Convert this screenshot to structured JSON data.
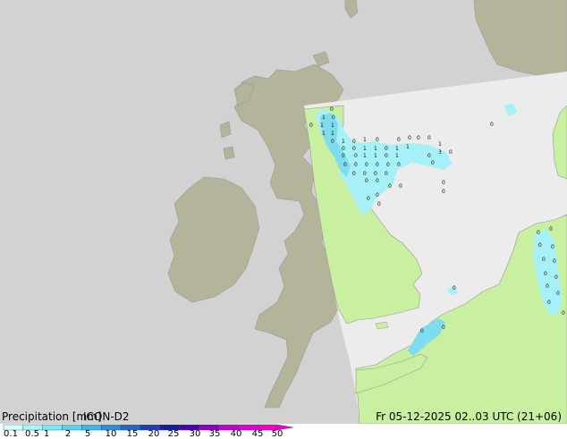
{
  "title": "Precipitation [mm]",
  "model": "ICON-D2",
  "datetime": "Fr 05-12-2025 02..03 UTC (21+06)",
  "colorbar": {
    "ticks": [
      "0.1",
      "0.5",
      "1",
      "2",
      "5",
      "10",
      "15",
      "20",
      "25",
      "30",
      "35",
      "40",
      "45",
      "50"
    ],
    "colors": [
      "#d0ffff",
      "#a8f5ff",
      "#7fe6f7",
      "#5ad2ec",
      "#3cb6e6",
      "#2b8fdc",
      "#2466cc",
      "#1e3fb8",
      "#1a1aa0",
      "#4b00b4",
      "#8a00c8",
      "#c000d2",
      "#e000d8",
      "#f000d0"
    ]
  },
  "colors": {
    "sea_outside": "#d2d2d2",
    "land_outside": "#b4b49a",
    "sea_domain": "#ececec",
    "land_domain": "#c8f0a0",
    "precip_light": "#a6f0f7",
    "precip_med": "#7fdcef",
    "coast": "#888888"
  },
  "precip_values": [
    "0",
    "1",
    "0",
    "1",
    "1",
    "0",
    "1",
    "1",
    "1",
    "0",
    "0",
    "1",
    "0",
    "0",
    "0",
    "0",
    "0",
    "0",
    "0",
    "1",
    "1",
    "0",
    "1",
    "1",
    "1",
    "0",
    "0",
    "1",
    "1",
    "0",
    "1",
    "0",
    "3",
    "0",
    "0",
    "0",
    "0",
    "0",
    "0",
    "0",
    "0",
    "0",
    "0",
    "0",
    "0",
    "0",
    "0",
    "0",
    "0",
    "0",
    "0",
    "0",
    "0",
    "0",
    "0",
    "0",
    "0",
    "0",
    "0",
    "0",
    "0",
    "0",
    "0",
    "0",
    "0",
    "0",
    "0",
    "0",
    "0",
    "0"
  ]
}
